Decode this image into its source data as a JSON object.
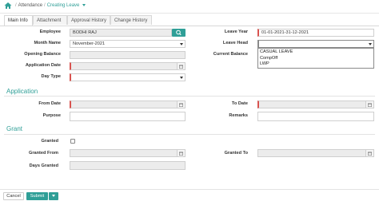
{
  "header": {
    "home_icon": "home-icon",
    "breadcrumb": {
      "parent": "Attendance",
      "current": "Creating Leave",
      "separator": "/"
    }
  },
  "tabs": [
    {
      "label": "Main Info",
      "active": true
    },
    {
      "label": "Attachment",
      "active": false
    },
    {
      "label": "Approval History",
      "active": false
    },
    {
      "label": "Change History",
      "active": false
    }
  ],
  "form": {
    "employee": {
      "label": "Employee",
      "value": "BODHI RAJ"
    },
    "month_name": {
      "label": "Month Name",
      "value": "November-2021"
    },
    "opening_balance": {
      "label": "Opening Balance",
      "value": ""
    },
    "application_date": {
      "label": "Application Date",
      "value": ""
    },
    "day_type": {
      "label": "Day Type",
      "value": ""
    },
    "leave_year": {
      "label": "Leave Year",
      "value": "01-01-2021-31-12-2021"
    },
    "leave_head": {
      "label": "Leave Head",
      "value": "",
      "options": [
        "CASUAL LEAVE",
        "CompOff",
        "LWP"
      ]
    },
    "current_balance": {
      "label": "Current Balance",
      "value": ""
    }
  },
  "application": {
    "title": "Application",
    "from_date": {
      "label": "From Date",
      "value": ""
    },
    "to_date": {
      "label": "To Date",
      "value": ""
    },
    "purpose": {
      "label": "Purpose",
      "value": ""
    },
    "remarks": {
      "label": "Remarks",
      "value": ""
    }
  },
  "grant": {
    "title": "Grant",
    "granted": {
      "label": "Granted",
      "checked": false
    },
    "granted_from": {
      "label": "Granted From",
      "value": ""
    },
    "granted_to": {
      "label": "Granted To",
      "value": ""
    },
    "days_granted": {
      "label": "Days Granted",
      "value": ""
    }
  },
  "footer": {
    "cancel_label": "Cancel",
    "submit_label": "Submit"
  },
  "colors": {
    "accent": "#2f9f97",
    "required": "#d9534f",
    "readonly_bg": "#ececec"
  }
}
